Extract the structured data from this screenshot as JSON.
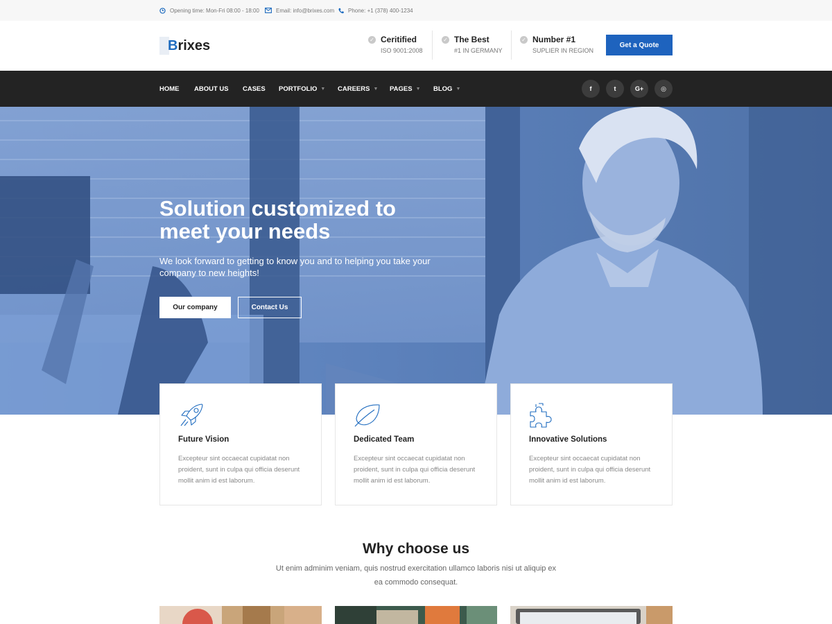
{
  "topbar": {
    "opening": "Opening time: Mon-Fri 08:00 - 18:00",
    "email": "Email: info@brixes.com",
    "phone": "Phone: +1 (378) 400-1234"
  },
  "header": {
    "logo_initial": "B",
    "logo_rest": "rixes",
    "features": [
      {
        "title": "Ceritified",
        "subtitle": "ISO 9001:2008"
      },
      {
        "title": "The Best",
        "subtitle": "#1 IN GERMANY"
      },
      {
        "title": "Number #1",
        "subtitle": "SUPLIER IN REGION"
      }
    ],
    "quote_label": "Get a Quote"
  },
  "nav": {
    "items": [
      {
        "label": "HOME"
      },
      {
        "label": "ABOUT US"
      },
      {
        "label": "CASES"
      },
      {
        "label": "PORTFOLIO"
      },
      {
        "label": "CAREERS"
      },
      {
        "label": "PAGES"
      },
      {
        "label": "BLOG"
      }
    ],
    "social": [
      {
        "icon": "facebook-icon",
        "glyph": "f"
      },
      {
        "icon": "twitter-icon",
        "glyph": "t"
      },
      {
        "icon": "google-plus-icon",
        "glyph": "G+"
      },
      {
        "icon": "instagram-icon",
        "glyph": "◎"
      }
    ]
  },
  "hero": {
    "title": "Solution customized to meet your needs",
    "text": "We look forward to getting to know you and to helping you take your company to new heights!",
    "primary_label": "Our company",
    "secondary_label": "Contact Us"
  },
  "cards": [
    {
      "icon": "rocket-icon",
      "title": "Future Vision",
      "text": "Excepteur sint occaecat cupidatat non proident, sunt in culpa qui officia deserunt mollit anim id est laborum."
    },
    {
      "icon": "leaf-icon",
      "title": "Dedicated Team",
      "text": "Excepteur sint occaecat cupidatat non proident, sunt in culpa qui officia deserunt mollit anim id est laborum."
    },
    {
      "icon": "puzzle-icon",
      "title": "Innovative Solutions",
      "text": "Excepteur sint occaecat cupidatat non proident, sunt in culpa qui officia deserunt mollit anim id est laborum."
    }
  ],
  "why": {
    "title": "Why choose us",
    "subtitle": "Ut enim adminim veniam, quis nostrud exercitation ullamco laboris nisi ut aliquip ex ea commodo consequat."
  },
  "colors": {
    "accent": "#1e63be",
    "nav_bg": "#232323",
    "hero_tint": "#5a7fb8"
  }
}
